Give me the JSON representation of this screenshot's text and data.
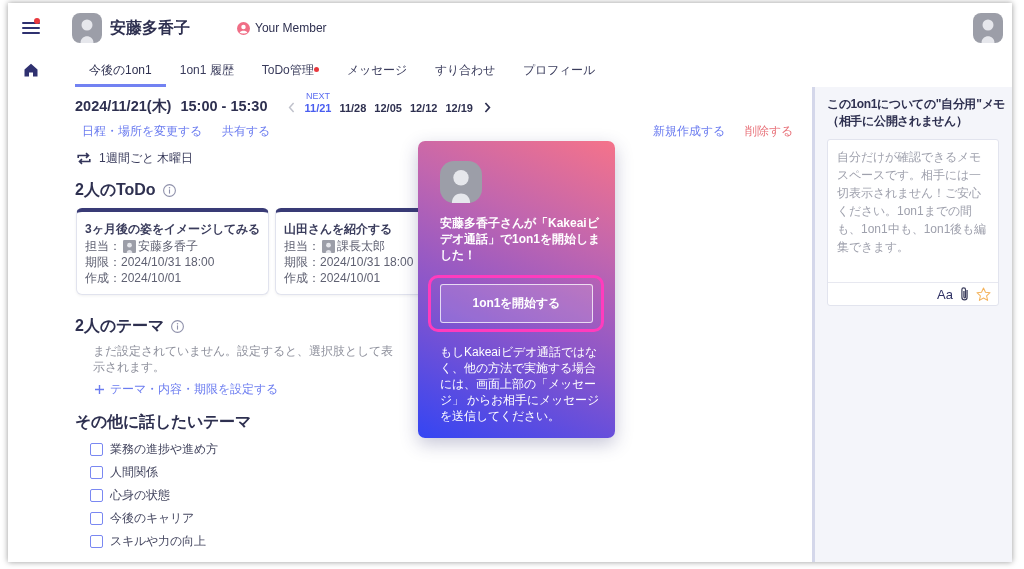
{
  "rail": {
    "menu_notification": true
  },
  "header": {
    "member_name": "安藤多香子",
    "member_role": "Your Member"
  },
  "tabs": [
    {
      "label": "今後の1on1",
      "selected": true,
      "notification": false
    },
    {
      "label": "1on1 履歴",
      "selected": false,
      "notification": false
    },
    {
      "label": "ToDo管理",
      "selected": false,
      "notification": true
    },
    {
      "label": "メッセージ",
      "selected": false,
      "notification": false
    },
    {
      "label": "すり合わせ",
      "selected": false,
      "notification": false
    },
    {
      "label": "プロフィール",
      "selected": false,
      "notification": false
    }
  ],
  "schedule": {
    "date": "2024/11/21(木)",
    "time": "15:00 - 15:30",
    "prev_disabled": true,
    "next_disabled": false,
    "dates": [
      {
        "label": "11/21",
        "selected": true,
        "tag": "NEXT"
      },
      {
        "label": "11/28",
        "selected": false
      },
      {
        "label": "12/05",
        "selected": false
      },
      {
        "label": "12/12",
        "selected": false
      },
      {
        "label": "12/19",
        "selected": false
      }
    ],
    "left_actions": [
      "日程・場所を変更する",
      "共有する"
    ],
    "right_actions": [
      {
        "label": "新規作成する",
        "kind": "primary"
      },
      {
        "label": "削除する",
        "kind": "danger"
      }
    ],
    "recurrence": "1週間ごと 木曜日"
  },
  "todo": {
    "title": "2人のToDo",
    "cards": [
      {
        "title": "3ヶ月後の姿をイメージしてみる",
        "assignee_label": "担当：",
        "assignee": "安藤多香子",
        "due": "期限：2024/10/31 18:00",
        "created": "作成：2024/10/01"
      },
      {
        "title": "山田さんを紹介する",
        "assignee_label": "担当：",
        "assignee": "課長太郎",
        "due": "期限：2024/10/31 18:00",
        "created": "作成：2024/10/01"
      }
    ]
  },
  "theme": {
    "title": "2人のテーマ",
    "empty_text": "まだ設定されていません。設定すると、選択肢として表示されます。",
    "add_link": "テーマ・内容・期限を設定する"
  },
  "other_themes": {
    "title": "その他に話したいテーマ",
    "items": [
      {
        "label": "業務の進捗や進め方",
        "checked": false
      },
      {
        "label": "人間関係",
        "checked": false
      },
      {
        "label": "心身の状態",
        "checked": false
      },
      {
        "label": "今後のキャリア",
        "checked": false
      },
      {
        "label": "スキルや力の向上",
        "checked": false
      }
    ]
  },
  "popup": {
    "message": "安藤多香子さんが「Kakeaiビデオ通話」で1on1を開始しました！",
    "button": "1on1を開始する",
    "highlighted": true,
    "note": "もしKakeaiビデオ通話ではなく、他の方法で実施する場合には、画面上部の「メッセージ」 からお相手にメッセージを送信してください。"
  },
  "memo": {
    "title": "この1on1についての\"自分用\"メモ",
    "subtitle": "（相手に公開されません）",
    "placeholder": "自分だけが確認できるメモスペースです。相手には一切表示されません！ご安心ください。1on1までの間も、1on1中も、1on1後も編集できます。",
    "format_button": "Aa",
    "starred": false
  }
}
